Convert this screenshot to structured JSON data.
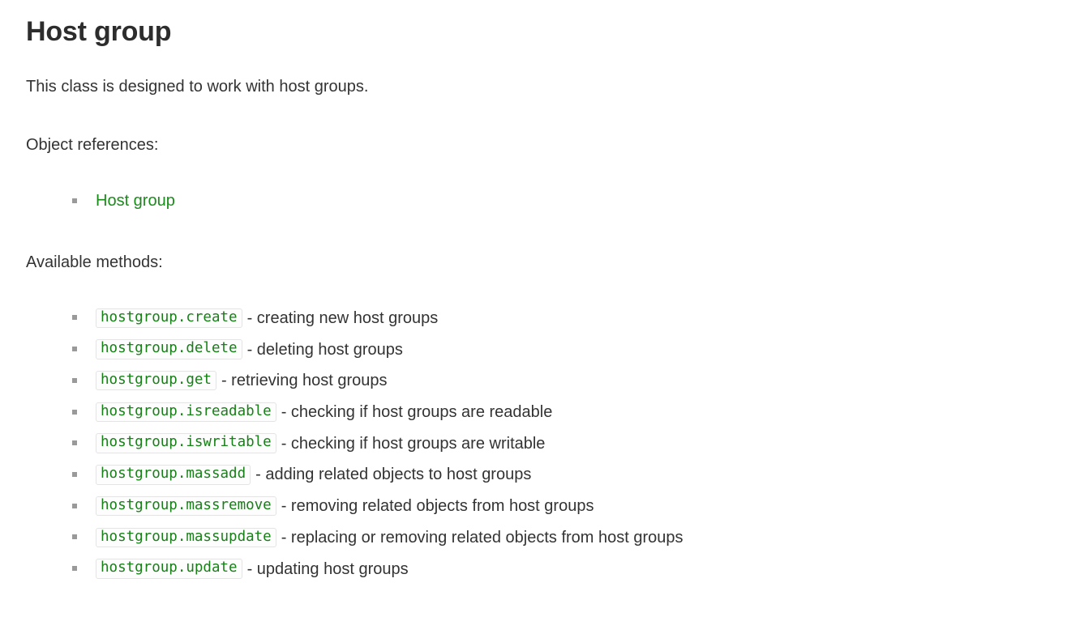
{
  "page": {
    "title": "Host group",
    "intro": "This class is designed to work with host groups.",
    "object_references_heading": "Object references:",
    "available_methods_heading": "Available methods:",
    "bullet_icon": "square-bullet-icon",
    "colors": {
      "link_green": "#1a8c1a",
      "code_green": "#178017",
      "text": "#333333",
      "title": "#2d2d2d",
      "chip_background": "#fdfdfd",
      "chip_border": "#e4e4e4",
      "bullet": "#9a9a9a",
      "page_background": "#ffffff"
    }
  },
  "object_references": [
    {
      "label": "Host group"
    }
  ],
  "methods": [
    {
      "code": "hostgroup.create",
      "separator": "-",
      "description": "creating new host groups"
    },
    {
      "code": "hostgroup.delete",
      "separator": "-",
      "description": "deleting host groups"
    },
    {
      "code": "hostgroup.get",
      "separator": "-",
      "description": "retrieving host groups"
    },
    {
      "code": "hostgroup.isreadable",
      "separator": "-",
      "description": "checking if host groups are readable"
    },
    {
      "code": "hostgroup.iswritable",
      "separator": "-",
      "description": "checking if host groups are writable"
    },
    {
      "code": "hostgroup.massadd",
      "separator": "-",
      "description": "adding related objects to host groups"
    },
    {
      "code": "hostgroup.massremove",
      "separator": "-",
      "description": "removing related objects from host groups"
    },
    {
      "code": "hostgroup.massupdate",
      "separator": "-",
      "description": "replacing or removing related objects from host groups"
    },
    {
      "code": "hostgroup.update",
      "separator": "-",
      "description": "updating host groups"
    }
  ]
}
